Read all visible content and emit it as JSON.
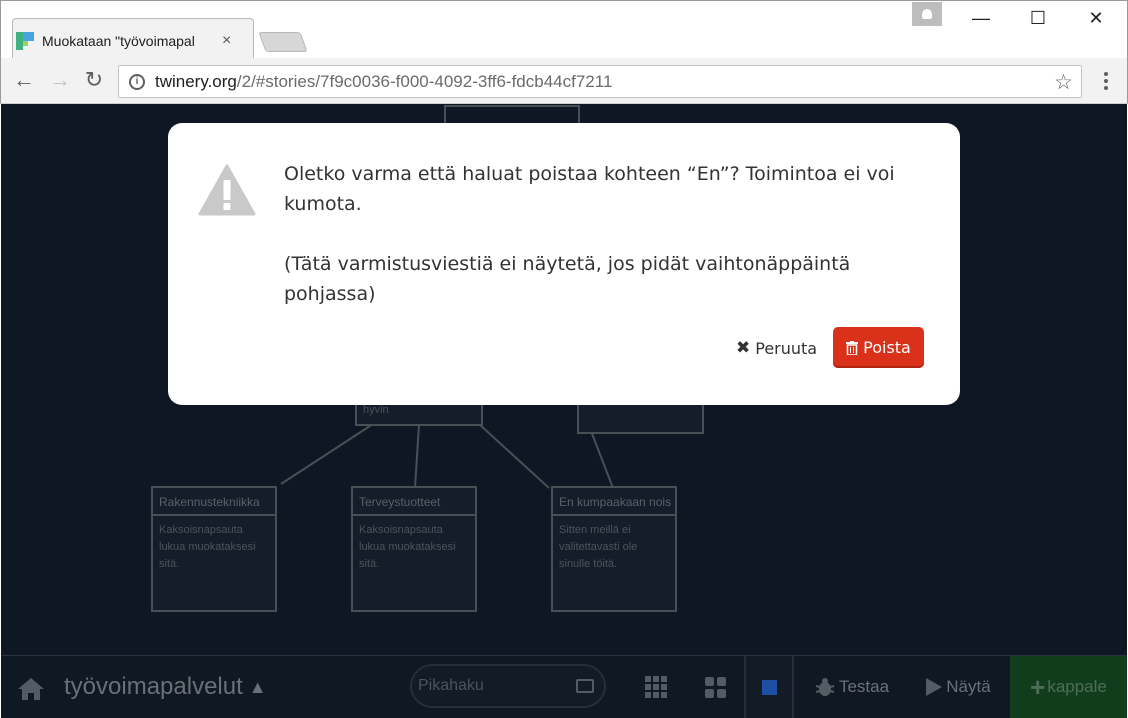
{
  "browser": {
    "tab_title": "Muokataan \"työvoimapal",
    "tab_close": "×",
    "url_host": "twinery.org",
    "url_rest": "/2/#stories/7f9c0036-f000-4092-3ff6-fdcb44cf7211",
    "window_minimize": "—",
    "window_maximize": "☐",
    "window_close": "✕",
    "back_icon": "←",
    "forward_icon": "→",
    "reload_icon": "↻",
    "star_icon": "☆"
  },
  "story_map": {
    "passages": [
      {
        "title": "Rakennustekniikka",
        "excerpt": "Kaksoisnapsauta lukua muokataksesi sitä."
      },
      {
        "title": "Terveystuotteet",
        "excerpt": "Kaksoisnapsauta lukua muokataksesi sitä."
      },
      {
        "title": "En kumpaakaan nois",
        "excerpt": "Sitten meillä ei valitettavasti ole sinulle töitä."
      },
      {
        "title": "",
        "excerpt": "hyvin"
      }
    ]
  },
  "dialog": {
    "message": "Oletko varma että haluat poistaa kohteen “En”? Toimintoa ei voi kumota.",
    "note": "(Tätä varmistusviestiä ei näytetä, jos pidät vaihtonäppäintä pohjassa)",
    "cancel_label": "Peruuta",
    "cancel_icon": "✖",
    "delete_label": "Poista",
    "accent_color": "#d9311a"
  },
  "bottom_bar": {
    "story_name": "työvoimapalvelut",
    "story_caret": "▲",
    "search_placeholder": "Pikahaku",
    "test_label": "Testaa",
    "play_label": "Näytä",
    "add_label": "kappale",
    "add_icon": "+"
  }
}
